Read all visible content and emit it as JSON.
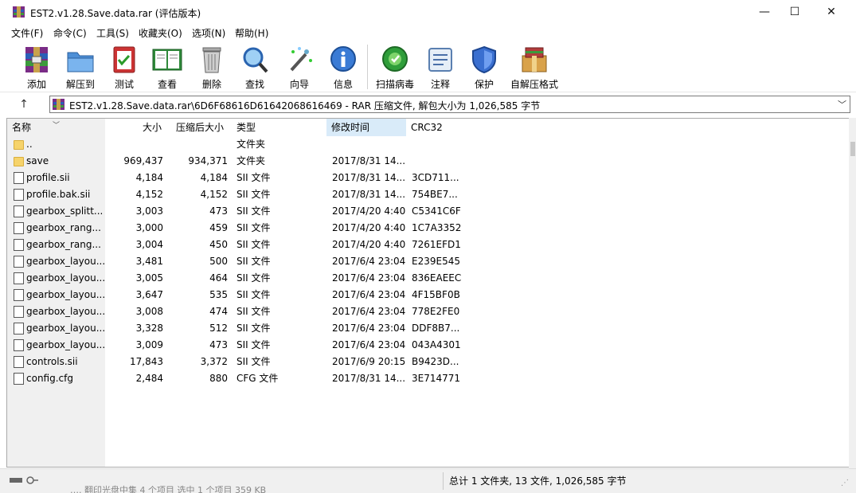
{
  "window": {
    "title": "EST2.v1.28.Save.data.rar (评估版本)",
    "minimize": "—",
    "maximize": "☐",
    "close": "✕"
  },
  "menu": [
    "文件(F)",
    "命令(C)",
    "工具(S)",
    "收藏夹(O)",
    "选项(N)",
    "帮助(H)"
  ],
  "toolbar": [
    {
      "label": "添加",
      "icon": "add-archive-icon"
    },
    {
      "label": "解压到",
      "icon": "extract-folder-icon"
    },
    {
      "label": "测试",
      "icon": "test-clipboard-icon"
    },
    {
      "label": "查看",
      "icon": "view-book-icon"
    },
    {
      "label": "删除",
      "icon": "trash-icon"
    },
    {
      "label": "查找",
      "icon": "magnifier-icon"
    },
    {
      "label": "向导",
      "icon": "wizard-wand-icon"
    },
    {
      "label": "信息",
      "icon": "info-icon"
    },
    {
      "label": "扫描病毒",
      "icon": "virus-scan-icon"
    },
    {
      "label": "注释",
      "icon": "comment-icon"
    },
    {
      "label": "保护",
      "icon": "shield-icon"
    },
    {
      "label": "自解压格式",
      "icon": "sfx-box-icon"
    }
  ],
  "address": {
    "up": "↑",
    "path": "EST2.v1.28.Save.data.rar\\6D6F68616D61642068616469 - RAR 压缩文件, 解包大小为 1,026,585 字节",
    "dropdown": "﹀"
  },
  "columns": {
    "name": "名称",
    "size": "大小",
    "packed": "压缩后大小",
    "type": "类型",
    "mtime": "修改时间",
    "crc": "CRC32",
    "sort_arrow": "﹀"
  },
  "files": [
    {
      "kind": "folder",
      "name": "..",
      "size": "",
      "packed": "",
      "type": "文件夹",
      "mtime": "",
      "crc": ""
    },
    {
      "kind": "folder",
      "name": "save",
      "size": "969,437",
      "packed": "934,371",
      "type": "文件夹",
      "mtime": "2017/8/31 14...",
      "crc": ""
    },
    {
      "kind": "file",
      "name": "profile.sii",
      "size": "4,184",
      "packed": "4,184",
      "type": "SII 文件",
      "mtime": "2017/8/31 14...",
      "crc": "3CD711..."
    },
    {
      "kind": "file",
      "name": "profile.bak.sii",
      "size": "4,152",
      "packed": "4,152",
      "type": "SII 文件",
      "mtime": "2017/8/31 14...",
      "crc": "754BE7..."
    },
    {
      "kind": "file",
      "name": "gearbox_splitt...",
      "size": "3,003",
      "packed": "473",
      "type": "SII 文件",
      "mtime": "2017/4/20 4:40",
      "crc": "C5341C6F"
    },
    {
      "kind": "file",
      "name": "gearbox_rang...",
      "size": "3,000",
      "packed": "459",
      "type": "SII 文件",
      "mtime": "2017/4/20 4:40",
      "crc": "1C7A3352"
    },
    {
      "kind": "file",
      "name": "gearbox_rang...",
      "size": "3,004",
      "packed": "450",
      "type": "SII 文件",
      "mtime": "2017/4/20 4:40",
      "crc": "7261EFD1"
    },
    {
      "kind": "file",
      "name": "gearbox_layou...",
      "size": "3,481",
      "packed": "500",
      "type": "SII 文件",
      "mtime": "2017/6/4 23:04",
      "crc": "E239E545"
    },
    {
      "kind": "file",
      "name": "gearbox_layou...",
      "size": "3,005",
      "packed": "464",
      "type": "SII 文件",
      "mtime": "2017/6/4 23:04",
      "crc": "836EAEEC"
    },
    {
      "kind": "file",
      "name": "gearbox_layou...",
      "size": "3,647",
      "packed": "535",
      "type": "SII 文件",
      "mtime": "2017/6/4 23:04",
      "crc": "4F15BF0B"
    },
    {
      "kind": "file",
      "name": "gearbox_layou...",
      "size": "3,008",
      "packed": "474",
      "type": "SII 文件",
      "mtime": "2017/6/4 23:04",
      "crc": "778E2FE0"
    },
    {
      "kind": "file",
      "name": "gearbox_layou...",
      "size": "3,328",
      "packed": "512",
      "type": "SII 文件",
      "mtime": "2017/6/4 23:04",
      "crc": "DDF8B7..."
    },
    {
      "kind": "file",
      "name": "gearbox_layou...",
      "size": "3,009",
      "packed": "473",
      "type": "SII 文件",
      "mtime": "2017/6/4 23:04",
      "crc": "043A4301"
    },
    {
      "kind": "file",
      "name": "controls.sii",
      "size": "17,843",
      "packed": "3,372",
      "type": "SII 文件",
      "mtime": "2017/6/9 20:15",
      "crc": "B9423D..."
    },
    {
      "kind": "file",
      "name": "config.cfg",
      "size": "2,484",
      "packed": "880",
      "type": "CFG 文件",
      "mtime": "2017/8/31 14...",
      "crc": "3E714771"
    }
  ],
  "status": {
    "summary": "总计 1 文件夹, 13 文件, 1,026,585 字节",
    "ghost": "…. 翻印光盘中集 4 个项目 选中 1 个项目 359 KB",
    "grip": "⋰"
  }
}
